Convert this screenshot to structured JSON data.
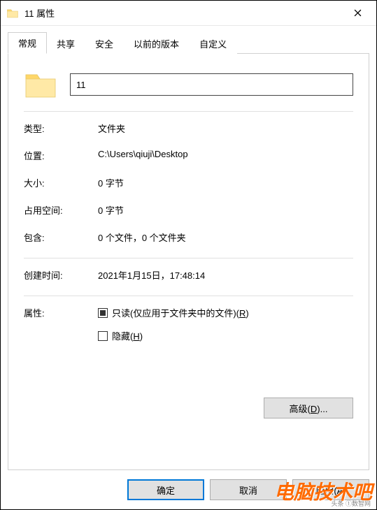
{
  "window": {
    "title": "11 属性"
  },
  "tabs": {
    "t0": "常规",
    "t1": "共享",
    "t2": "安全",
    "t3": "以前的版本",
    "t4": "自定义"
  },
  "general": {
    "name_value": "11",
    "rows": {
      "type_label": "类型:",
      "type_value": "文件夹",
      "location_label": "位置:",
      "location_value": "C:\\Users\\qiuji\\Desktop",
      "size_label": "大小:",
      "size_value": "0 字节",
      "sizeondisk_label": "占用空间:",
      "sizeondisk_value": "0 字节",
      "contains_label": "包含:",
      "contains_value": "0 个文件，0 个文件夹",
      "created_label": "创建时间:",
      "created_value": "2021年1月15日，17:48:14"
    },
    "attributes": {
      "label": "属性:",
      "readonly_prefix": "只读(仅应用于文件夹中的文件)(",
      "readonly_key": "R",
      "readonly_suffix": ")",
      "hidden_prefix": "隐藏(",
      "hidden_key": "H",
      "hidden_suffix": ")",
      "advanced_prefix": "高级(",
      "advanced_key": "D",
      "advanced_suffix": ")..."
    }
  },
  "footer": {
    "ok": "确定",
    "cancel": "取消",
    "apply": "应用(A)"
  },
  "watermark": {
    "big": "电脑技术吧",
    "small": "头条 ①数智网"
  }
}
